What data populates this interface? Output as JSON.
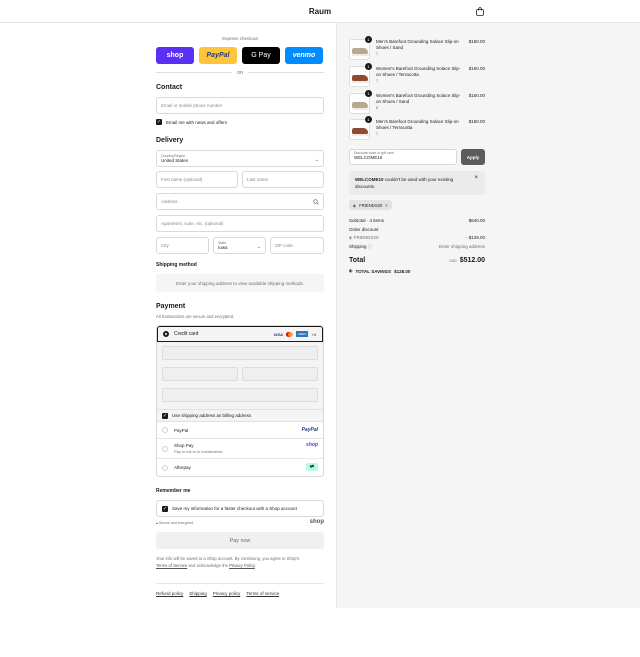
{
  "brand": "Raum",
  "express": {
    "title": "Express checkout",
    "buttons": {
      "shop": "shop",
      "paypal": "PayPal",
      "gpay": "G Pay",
      "venmo": "venmo"
    },
    "or": "OR"
  },
  "contact": {
    "title": "Contact",
    "phone_placeholder": "Email or mobile phone number",
    "news_label": "Email me with news and offers"
  },
  "delivery": {
    "title": "Delivery",
    "country_label": "Country/Region",
    "country_value": "United States",
    "first_name": "First name (optional)",
    "last_name": "Last name",
    "address": "Address",
    "apartment": "Apartment, suite, etc. (optional)",
    "city": "City",
    "state_label": "State",
    "state_value": "Iowa",
    "zip": "ZIP code"
  },
  "shipping_method": {
    "title": "Shipping method",
    "info": "Enter your shipping address to view available shipping methods."
  },
  "payment": {
    "title": "Payment",
    "subtitle": "All transactions are secure and encrypted.",
    "credit_card": "Credit card",
    "card_logos": {
      "visa": "VISA",
      "amex": "AMEX",
      "more": "+4"
    },
    "billing_label": "Use shipping address as billing address",
    "methods": [
      {
        "label": "PayPal",
        "badge": "PayPal",
        "sub": ""
      },
      {
        "label": "Shop Pay",
        "badge": "shop",
        "sub": "Pay in full or in installments"
      },
      {
        "label": "Afterpay",
        "badge": "",
        "sub": ""
      }
    ]
  },
  "remember": {
    "title": "Remember me",
    "save_label": "Save my information for a faster checkout with a Shop account",
    "secure": "Secure and encrypted",
    "shop": "shop"
  },
  "pay_now": "Pay now",
  "legal": {
    "line1": "Your info will be saved to a Shop account. By continuing, you agree to Shop's",
    "terms": "Terms of Service",
    "mid": " and acknowledge the ",
    "privacy": "Privacy Policy",
    "end": "."
  },
  "footer": [
    "Refund policy",
    "Shipping",
    "Privacy policy",
    "Terms of service"
  ],
  "cart": {
    "items": [
      {
        "name": "Men's Barefoot Grounding Solace Slip-on Shoes / Sand",
        "variant": "7",
        "price": "$160.00",
        "qty": "1",
        "color": "#b8a98e"
      },
      {
        "name": "Women's Barefoot Grounding Solace Slip-on Shoes / Terracotta",
        "variant": "7",
        "price": "$160.00",
        "qty": "1",
        "color": "#8f4a33"
      },
      {
        "name": "Women's Barefoot Grounding Solace Slip-on Shoes / Sand",
        "variant": "6",
        "price": "$160.00",
        "qty": "1",
        "color": "#b8a98e"
      },
      {
        "name": "Men's Barefoot Grounding Solace Slip-on Shoes / Terracotta",
        "variant": "7",
        "price": "$160.00",
        "qty": "1",
        "color": "#8f4a33"
      }
    ],
    "discount_label": "Discount code or gift card",
    "discount_value": "WELCOME10",
    "apply": "Apply",
    "error_code": "WELCOME10",
    "error_text": " couldn't be used with your existing discounts.",
    "chip": "FRIENDS20",
    "subtotal_label": "Subtotal · 4 items",
    "subtotal_value": "$640.00",
    "order_discount": "Order discount",
    "discount_code": "FRIENDS20",
    "discount_amount": "- $128.00",
    "shipping_label": "Shipping",
    "shipping_value": "Enter shipping address",
    "total_label": "Total",
    "currency": "USD",
    "total_value": "$512.00",
    "savings_label": "TOTAL SAVINGS",
    "savings_value": "$128.00"
  }
}
